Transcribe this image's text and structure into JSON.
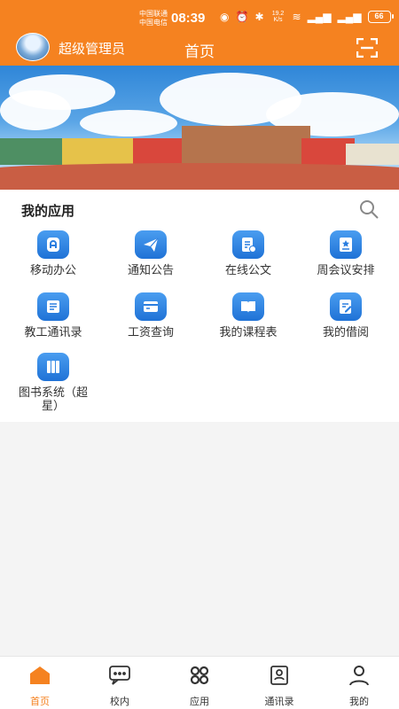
{
  "status_bar": {
    "carrier1": "中国联通",
    "carrier2": "中国电信",
    "time": "08:39",
    "net_speed": "19.2 K/s",
    "battery": "66"
  },
  "header": {
    "user_name": "超级管理员",
    "title": "首页",
    "accent_color": "#f58220"
  },
  "apps": {
    "title": "我的应用",
    "items": [
      {
        "label": "移动办公",
        "icon": "mobile-office-icon"
      },
      {
        "label": "通知公告",
        "icon": "paper-plane-icon"
      },
      {
        "label": "在线公文",
        "icon": "document-icon"
      },
      {
        "label": "周会议安排",
        "icon": "meeting-board-icon"
      },
      {
        "label": "教工通讯录",
        "icon": "contact-list-icon"
      },
      {
        "label": "工资查询",
        "icon": "card-icon"
      },
      {
        "label": "我的课程表",
        "icon": "open-book-icon"
      },
      {
        "label": "我的借阅",
        "icon": "notebook-edit-icon"
      },
      {
        "label": "图书系统（超星）",
        "icon": "library-books-icon"
      }
    ]
  },
  "bottom_nav": [
    {
      "label": "首页",
      "icon": "home-icon",
      "active": true
    },
    {
      "label": "校内",
      "icon": "chat-icon",
      "active": false
    },
    {
      "label": "应用",
      "icon": "apps-grid-icon",
      "active": false
    },
    {
      "label": "通讯录",
      "icon": "address-book-icon",
      "active": false
    },
    {
      "label": "我的",
      "icon": "person-icon",
      "active": false
    }
  ]
}
